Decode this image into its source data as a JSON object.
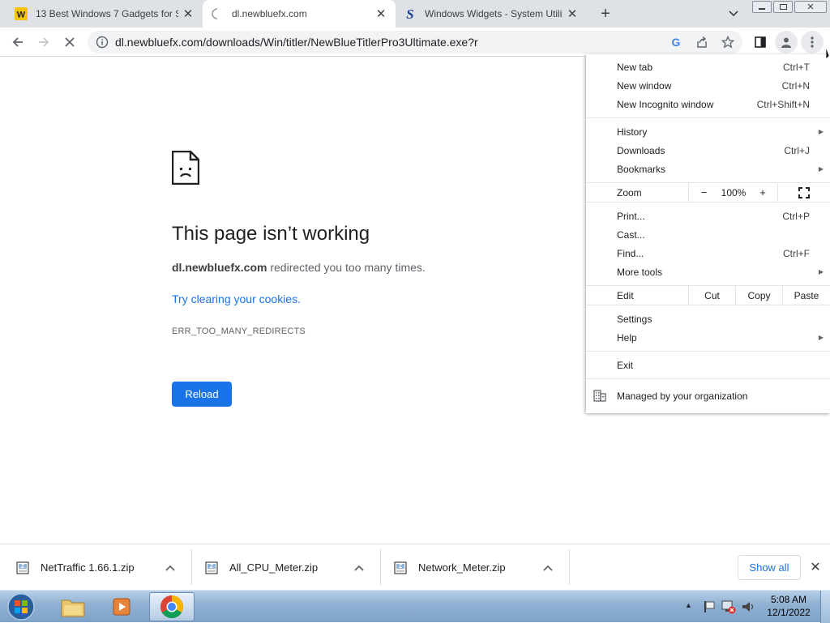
{
  "tabs": [
    {
      "title": "13 Best Windows 7 Gadgets for S",
      "favicon": "w-favicon-icon",
      "active": false
    },
    {
      "title": "dl.newbluefx.com",
      "favicon": "loading-spinner-icon",
      "active": true
    },
    {
      "title": "Windows Widgets - System Utilit",
      "favicon": "s-favicon-icon",
      "active": false
    }
  ],
  "address_bar": {
    "url": "dl.newbluefx.com/downloads/Win/titler/NewBlueTitlerPro3Ultimate.exe?r"
  },
  "error_page": {
    "title": "This page isn’t working",
    "domain": "dl.newbluefx.com",
    "description_rest": " redirected you too many times.",
    "suggestion_link": "Try clearing your cookies.",
    "error_code": "ERR_TOO_MANY_REDIRECTS",
    "reload_label": "Reload"
  },
  "menu": {
    "new_tab": {
      "label": "New tab",
      "shortcut": "Ctrl+T"
    },
    "new_window": {
      "label": "New window",
      "shortcut": "Ctrl+N"
    },
    "new_incognito": {
      "label": "New Incognito window",
      "shortcut": "Ctrl+Shift+N"
    },
    "history": {
      "label": "History"
    },
    "downloads": {
      "label": "Downloads",
      "shortcut": "Ctrl+J"
    },
    "bookmarks": {
      "label": "Bookmarks"
    },
    "zoom": {
      "label": "Zoom",
      "minus": "−",
      "value": "100%",
      "plus": "+"
    },
    "print": {
      "label": "Print...",
      "shortcut": "Ctrl+P"
    },
    "cast": {
      "label": "Cast..."
    },
    "find": {
      "label": "Find...",
      "shortcut": "Ctrl+F"
    },
    "more_tools": {
      "label": "More tools"
    },
    "edit": {
      "label": "Edit",
      "cut": "Cut",
      "copy": "Copy",
      "paste": "Paste"
    },
    "settings": {
      "label": "Settings"
    },
    "help": {
      "label": "Help"
    },
    "exit": {
      "label": "Exit"
    },
    "managed": {
      "label": "Managed by your organization"
    }
  },
  "downloads_shelf": {
    "items": [
      {
        "name": "NetTraffic 1.66.1.zip"
      },
      {
        "name": "All_CPU_Meter.zip"
      },
      {
        "name": "Network_Meter.zip"
      }
    ],
    "show_all_label": "Show all"
  },
  "taskbar": {
    "time": "5:08 AM",
    "date": "12/1/2022"
  },
  "colors": {
    "accent": "#1a73e8",
    "tabstrip_bg": "#dee1e6"
  }
}
